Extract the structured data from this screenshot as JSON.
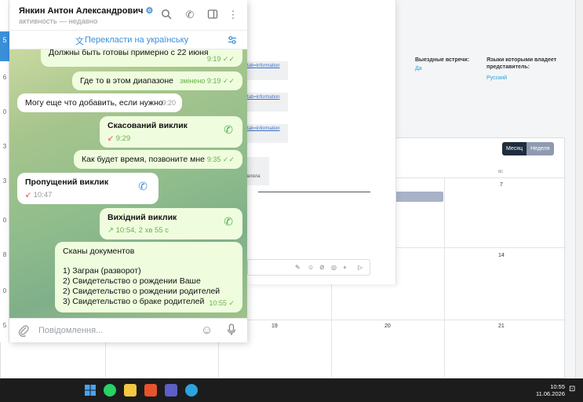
{
  "background": {
    "info": [
      {
        "label": "Выездные встречи:",
        "value": "Да"
      },
      {
        "label": "Языки которыми владеет представитель:",
        "value": "Русский"
      }
    ],
    "links": [
      "tab=information",
      "tab=information",
      "tab=information"
    ],
    "note": "вляла",
    "calendar": {
      "month_button": "Месяц",
      "week_button": "Неделя",
      "weekday_header": "вс",
      "days": [
        "7",
        "14",
        "19",
        "20",
        "21"
      ]
    }
  },
  "sidebar_strip": {
    "active": "5",
    "numbers": [
      "6",
      "0",
      "3",
      "3",
      "0",
      "8",
      "0",
      "5"
    ]
  },
  "telegram": {
    "contact_name": "Янкин Антон Александрович",
    "status": "активность — недавно",
    "translate_label": "Перекласти на українську",
    "messages": [
      {
        "type": "out",
        "text": "Должны быть готовы примерно с 22 июня",
        "time": "9:19"
      },
      {
        "type": "out",
        "text": "Где то в этом диапазоне",
        "time": "змінено 9:19"
      },
      {
        "type": "in",
        "text": "Могу еще что добавить, если нужно",
        "time": "9:20"
      },
      {
        "type": "out-call",
        "title": "Скасований виклик",
        "sub": "9:29"
      },
      {
        "type": "out",
        "text": "Как будет время, позвоните мне",
        "time": "9:35"
      },
      {
        "type": "in-call",
        "title": "Пропущений виклик",
        "sub": "10:47"
      },
      {
        "type": "out-call",
        "title": "Вихідний виклик",
        "sub": "10:54, 2 хв 55 с"
      },
      {
        "type": "out",
        "lines": [
          "Сканы документов",
          "",
          "1) Загран (разворот)",
          "2) Свидетельство о рождении Ваше",
          "2) Свидетельство о рождении родителей",
          "3) Свидетельство о браке родителей"
        ],
        "time": "10:55"
      }
    ],
    "input_placeholder": "Повідомлення..."
  },
  "taskbar": {
    "time": "10:55",
    "date": "11.06.2026"
  },
  "colors": {
    "accent": "#3a8fd9",
    "outgoing_bubble": "#effdde",
    "tick_green": "#6ab04c",
    "taskbar": "#1c1c1c"
  }
}
